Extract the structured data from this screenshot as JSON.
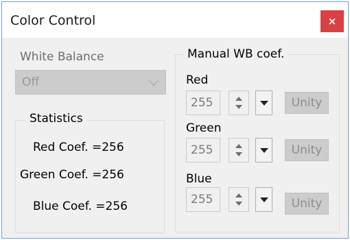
{
  "window": {
    "title": "Color Control",
    "close_glyph": "×"
  },
  "white_balance": {
    "label": "White Balance",
    "selected": "Off"
  },
  "statistics": {
    "title": "Statistics",
    "red": "Red Coef.  =256",
    "green": "Green Coef.  =256",
    "blue": "Blue Coef.  =256"
  },
  "manual_wb": {
    "title": "Manual WB coef.",
    "red": {
      "label": "Red",
      "value": "255",
      "button": "Unity"
    },
    "green": {
      "label": "Green",
      "value": "255",
      "button": "Unity"
    },
    "blue": {
      "label": "Blue",
      "value": "255",
      "button": "Unity"
    }
  },
  "colors": {
    "close": "#d94141",
    "border": "#6d9fd8",
    "panel": "#f0f0f0"
  }
}
